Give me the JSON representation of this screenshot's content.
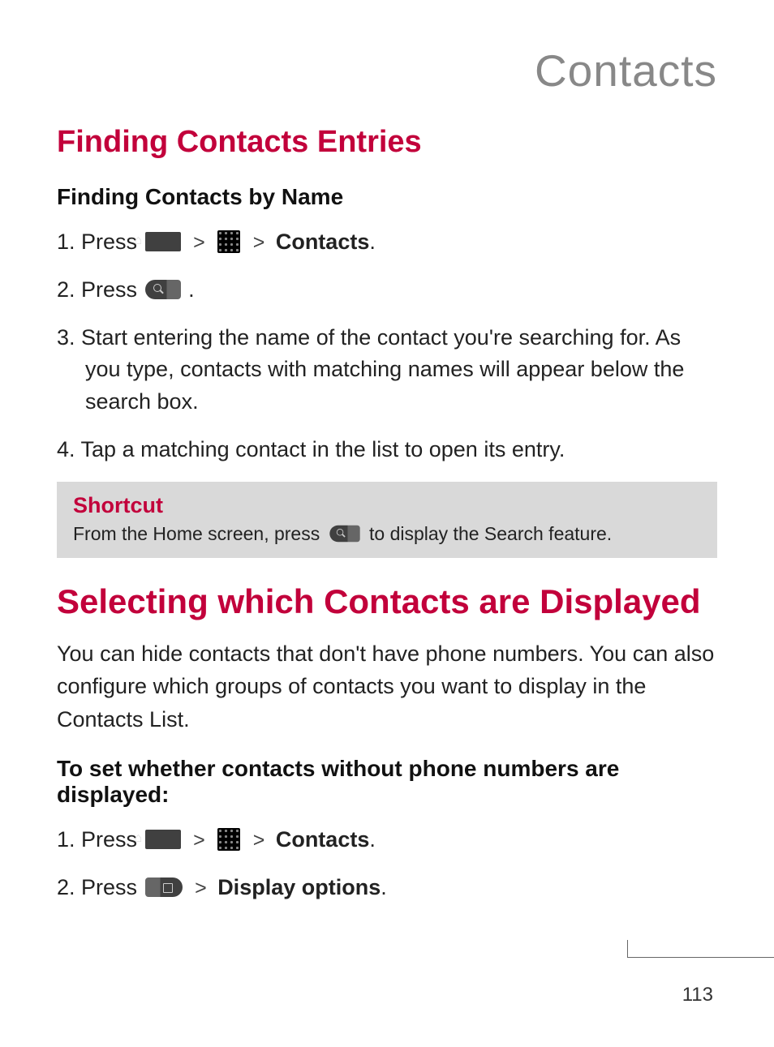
{
  "header": {
    "title": "Contacts"
  },
  "section1": {
    "title": "Finding Contacts Entries",
    "subheading": "Finding Contacts by Name",
    "step1_prefix": "1. Press ",
    "step1_bold": "Contacts",
    "step1_end": ".",
    "step2_prefix": "2. Press ",
    "step2_end": " .",
    "step3": "3. Start entering the name of the contact you're searching for. As you type, contacts with matching names will appear below the search box.",
    "step4": "4. Tap a matching contact in the list to open its entry."
  },
  "shortcut": {
    "title": "Shortcut",
    "text_before": "From the Home screen, press ",
    "text_after": " to display the Search feature."
  },
  "section2": {
    "title": "Selecting which Contacts are Displayed",
    "intro": "You can hide contacts that don't have phone numbers. You can also configure which groups of contacts you want to display in the Contacts List.",
    "subheading": "To set whether contacts without phone numbers are displayed:",
    "step1_prefix": "1. Press ",
    "step1_bold": "Contacts",
    "step1_end": ".",
    "step2_prefix": "2. Press ",
    "step2_bold": "Display options",
    "step2_end": "."
  },
  "glyphs": {
    "gt": ">"
  },
  "page_number": "113"
}
